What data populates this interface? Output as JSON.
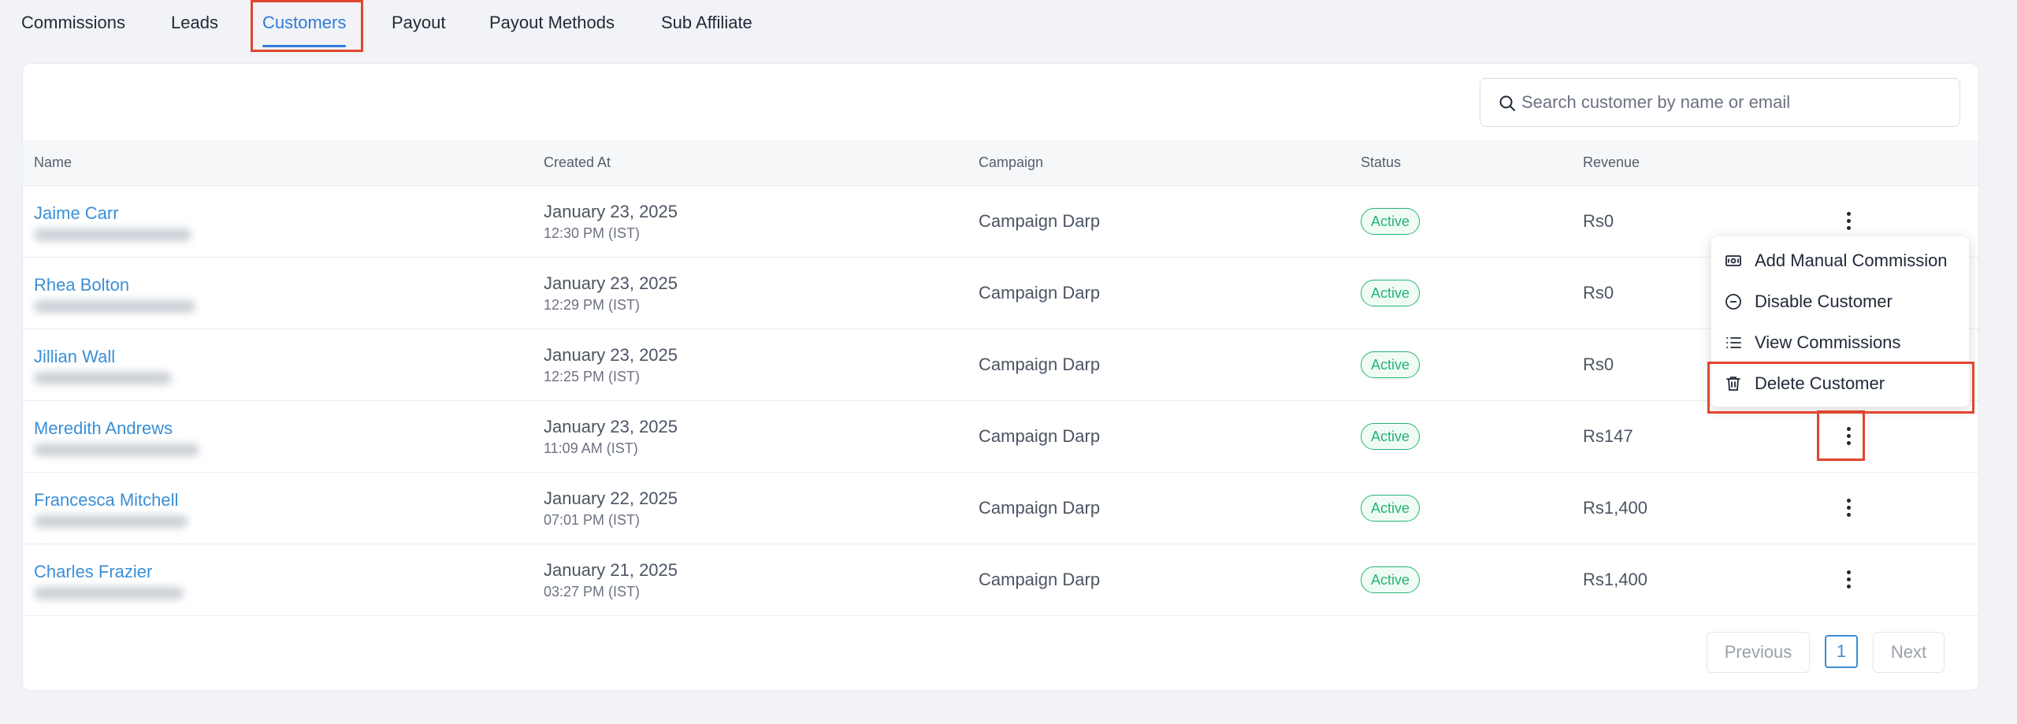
{
  "tabs": [
    {
      "label": "Commissions"
    },
    {
      "label": "Leads"
    },
    {
      "label": "Customers"
    },
    {
      "label": "Payout"
    },
    {
      "label": "Payout Methods"
    },
    {
      "label": "Sub Affiliate"
    }
  ],
  "active_tab": "Customers",
  "search": {
    "placeholder": "Search customer by name or email",
    "value": ""
  },
  "table": {
    "columns": [
      "Name",
      "Created At",
      "Campaign",
      "Status",
      "Revenue"
    ],
    "rows": [
      {
        "name": "Jaime Carr",
        "date": "January 23, 2025",
        "time": "12:30 PM (IST)",
        "campaign": "Campaign Darp",
        "status": "Active",
        "revenue": "Rs0"
      },
      {
        "name": "Rhea Bolton",
        "date": "January 23, 2025",
        "time": "12:29 PM (IST)",
        "campaign": "Campaign Darp",
        "status": "Active",
        "revenue": "Rs0"
      },
      {
        "name": "Jillian Wall",
        "date": "January 23, 2025",
        "time": "12:25 PM (IST)",
        "campaign": "Campaign Darp",
        "status": "Active",
        "revenue": "Rs0"
      },
      {
        "name": "Meredith Andrews",
        "date": "January 23, 2025",
        "time": "11:09 AM (IST)",
        "campaign": "Campaign Darp",
        "status": "Active",
        "revenue": "Rs147"
      },
      {
        "name": "Francesca Mitchell",
        "date": "January 22, 2025",
        "time": "07:01 PM (IST)",
        "campaign": "Campaign Darp",
        "status": "Active",
        "revenue": "Rs1,400"
      },
      {
        "name": "Charles Frazier",
        "date": "January 21, 2025",
        "time": "03:27 PM (IST)",
        "campaign": "Campaign Darp",
        "status": "Active",
        "revenue": "Rs1,400"
      }
    ]
  },
  "context_menu": {
    "items": [
      {
        "label": "Add Manual Commission",
        "icon": "cash-icon"
      },
      {
        "label": "Disable Customer",
        "icon": "minus-circle-icon"
      },
      {
        "label": "View Commissions",
        "icon": "list-icon"
      },
      {
        "label": "Delete Customer",
        "icon": "trash-icon"
      }
    ]
  },
  "pagination": {
    "previous": "Previous",
    "current_page": "1",
    "next": "Next"
  },
  "colors": {
    "accent": "#2f7ad9",
    "link": "#3a8fd6",
    "success": "#22b573",
    "highlight": "#e2452f"
  }
}
